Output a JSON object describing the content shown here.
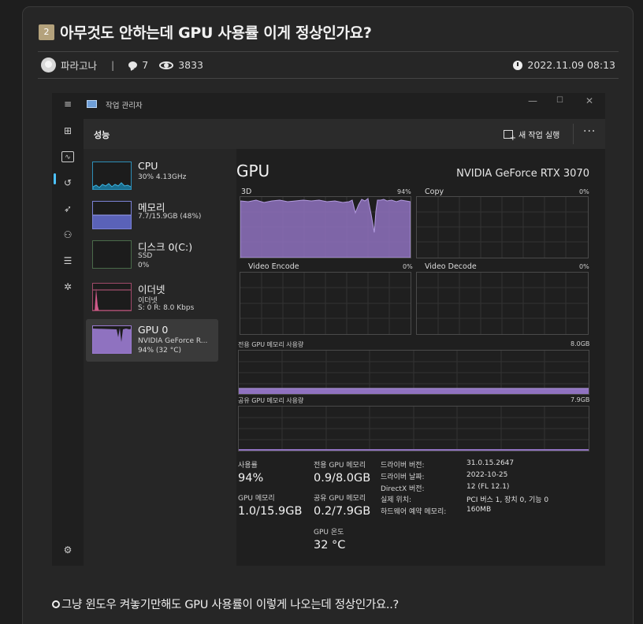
{
  "post": {
    "badge": "2",
    "title": "아무것도 안하는데 GPU 사용률 이게 정상인가요?",
    "author": "파라고나",
    "separator": "|",
    "comments": "7",
    "views": "3833",
    "date": "2022.11.09 08:13",
    "body": "그냥 윈도우 켜놓기만해도 GPU 사용률이 이렇게 나오는데 정상인가요..?"
  },
  "taskmanager": {
    "window_title": "작업 관리자",
    "minimize": "—",
    "maximize": "☐",
    "close": "✕",
    "section_title": "성능",
    "new_task_label": "새 작업 실행",
    "more_label": "···",
    "accent": "#4cc2ff",
    "devices": [
      {
        "name": "CPU",
        "sub1": "30% 4.13GHz",
        "sub2": ""
      },
      {
        "name": "메모리",
        "sub1": "7.7/15.9GB (48%)",
        "sub2": ""
      },
      {
        "name": "디스크 0(C:)",
        "sub1": "SSD",
        "sub2": "0%"
      },
      {
        "name": "이더넷",
        "sub1": "이더넷",
        "sub2": "S: 0 R: 8.0 Kbps"
      },
      {
        "name": "GPU 0",
        "sub1": "NVIDIA GeForce R...",
        "sub2": "94% (32 °C)"
      }
    ],
    "gpu": {
      "title": "GPU",
      "model": "NVIDIA GeForce RTX 3070",
      "graphs": {
        "g3d": {
          "label": "3D",
          "pct": "94%"
        },
        "copy": {
          "label": "Copy",
          "pct": "0%"
        },
        "encode": {
          "label": "Video Encode",
          "pct": "0%"
        },
        "decode": {
          "label": "Video Decode",
          "pct": "0%"
        },
        "dedicated": {
          "label": "전용 GPU 메모리 사용량",
          "max": "8.0GB"
        },
        "shared": {
          "label": "공유 GPU 메모리 사용량",
          "max": "7.9GB"
        }
      },
      "stats": {
        "usage_label": "사용률",
        "usage_value": "94%",
        "gpu_mem_label": "GPU 메모리",
        "gpu_mem_value": "1.0/15.9GB",
        "dedicated_label": "전용 GPU 메모리",
        "dedicated_value": "0.9/8.0GB",
        "shared_label": "공유 GPU 메모리",
        "shared_value": "0.2/7.9GB",
        "temp_label": "GPU 온도",
        "temp_value": "32 °C"
      },
      "info": [
        {
          "k": "드라이버 버전:",
          "v": "31.0.15.2647"
        },
        {
          "k": "드라이버 날짜:",
          "v": "2022-10-25"
        },
        {
          "k": "DirectX 버전:",
          "v": "12 (FL 12.1)"
        },
        {
          "k": "실제 위치:",
          "v": "PCI 버스 1, 장치 0, 기능 0"
        },
        {
          "k": "하드웨어 예약 메모리:",
          "v": "160MB"
        }
      ]
    }
  }
}
